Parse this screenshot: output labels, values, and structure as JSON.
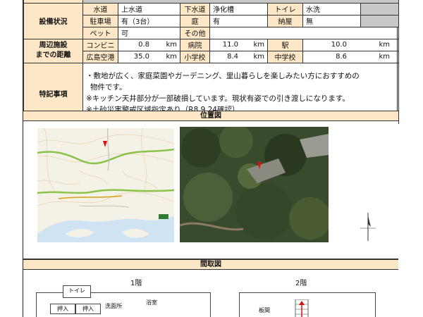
{
  "facilities": {
    "header": "設備状況",
    "row1": [
      "水道",
      "上水道",
      "下水道",
      "浄化槽",
      "トイレ",
      "水洗"
    ],
    "row2": [
      "駐車場",
      "有（3台）",
      "庭",
      "有",
      "納屋",
      "無"
    ],
    "row3": [
      "ペット",
      "可",
      "その他",
      ""
    ]
  },
  "distance": {
    "header_line1": "周辺施設",
    "header_line2": "までの距離",
    "row1": [
      {
        "label": "コンビニ",
        "value": "0.8",
        "unit": "km"
      },
      {
        "label": "病院",
        "value": "11.0",
        "unit": "km"
      },
      {
        "label": "駅",
        "value": "10.0",
        "unit": "km"
      }
    ],
    "row2": [
      {
        "label": "広島空港",
        "value": "35.0",
        "unit": "km"
      },
      {
        "label": "小学校",
        "value": "8.4",
        "unit": "km"
      },
      {
        "label": "中学校",
        "value": "8.6",
        "unit": "km"
      }
    ]
  },
  "notes": {
    "header": "特記事項",
    "lines": [
      "・敷地が広く、家庭菜園やガーデニング、里山暮らしを楽しみたい方におすすめの",
      "物件です。",
      "※キッチン天井部分が一部破損しています。現状有姿での引き渡しになります。",
      "※土砂災害警戒区域指定あり（R8.9.24確認）"
    ]
  },
  "location": {
    "title": "位置図"
  },
  "floorplan": {
    "title": "間取図",
    "floor1": "1階",
    "floor2": "2階",
    "rooms1": [
      "トイレ",
      "押入",
      "押入",
      "洗面所",
      "浴室"
    ],
    "rooms2": [
      "板間"
    ]
  },
  "colors": {
    "header_bg": "#fde7c6",
    "gray_cell": "#c8c8c8",
    "marker": "#e01010"
  }
}
